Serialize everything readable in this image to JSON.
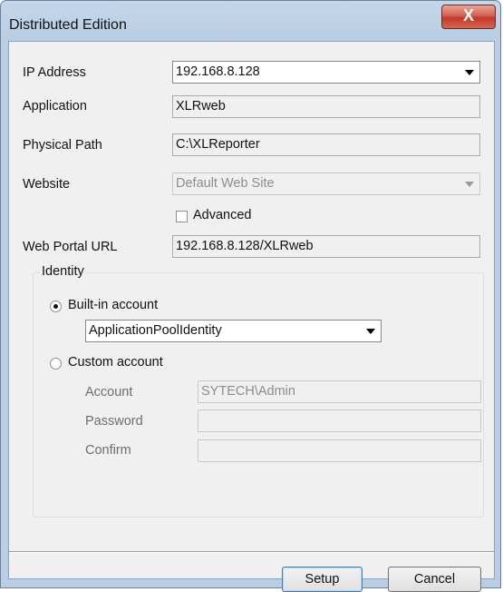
{
  "window": {
    "title": "Distributed Edition"
  },
  "fields": {
    "ip_address": {
      "label": "IP Address",
      "value": "192.168.8.128"
    },
    "application": {
      "label": "Application",
      "value": "XLRweb"
    },
    "physical_path": {
      "label": "Physical Path",
      "value": "C:\\XLReporter"
    },
    "website": {
      "label": "Website",
      "value": "Default Web Site"
    },
    "advanced": {
      "label": "Advanced",
      "checked": false
    },
    "web_portal_url": {
      "label": "Web Portal URL",
      "value": "192.168.8.128/XLRweb"
    }
  },
  "identity": {
    "title": "Identity",
    "builtin": {
      "label": "Built-in account",
      "selected": true,
      "value": "ApplicationPoolIdentity"
    },
    "custom": {
      "label": "Custom account",
      "selected": false
    },
    "account": {
      "label": "Account",
      "value": "SYTECH\\Admin"
    },
    "password": {
      "label": "Password",
      "value": ""
    },
    "confirm": {
      "label": "Confirm",
      "value": ""
    }
  },
  "buttons": {
    "setup": "Setup",
    "cancel": "Cancel",
    "close_glyph": "X"
  },
  "icons": [
    "close-icon",
    "dropdown-arrow-icon"
  ]
}
